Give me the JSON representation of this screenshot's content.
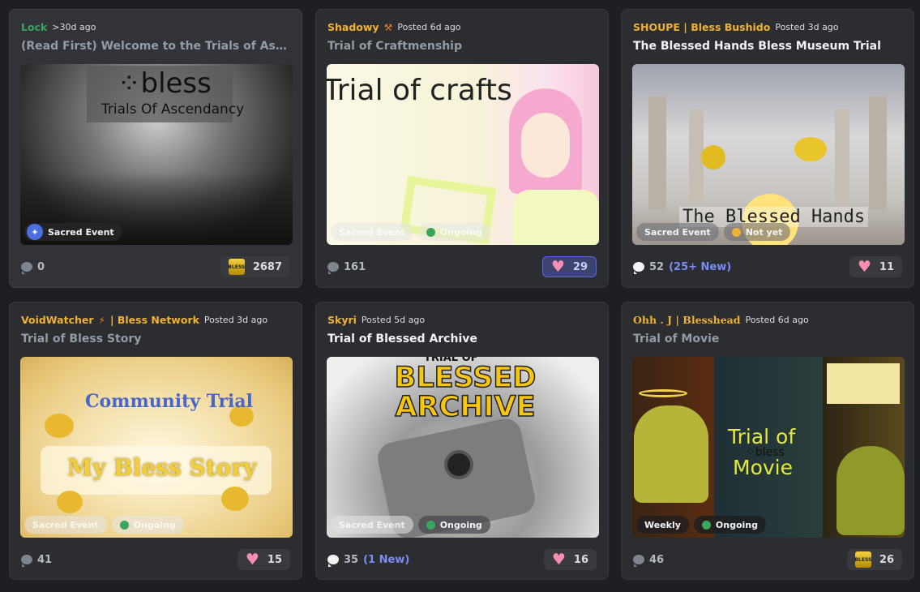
{
  "cards": [
    {
      "author": "Lock",
      "author_color": "#3ba55d",
      "posted": ">30d ago",
      "title": "(Read First) Welcome to the Trials of Ascend…",
      "image_text": {
        "logo": "⁘bless",
        "sub": "Trials Of Ascendancy"
      },
      "tags": [
        "Sacred Event"
      ],
      "comments": "0",
      "new": "",
      "reaction_icon": "bless-emoji",
      "reactions": "2687"
    },
    {
      "author": "Shadowy",
      "author_color": "#f0b232",
      "posted": "Posted 6d ago",
      "title": "Trial of Craftmenship",
      "image_text": {
        "headline": "Trial of crafts"
      },
      "tags": [
        "Sacred Event",
        "Ongoing"
      ],
      "comments": "161",
      "new": "",
      "reaction_icon": "heart-icon",
      "reactions": "29"
    },
    {
      "author": "SHOUPE | Bless Bushido",
      "author_color": "#f0b232",
      "posted": "Posted 3d ago",
      "title": "The Blessed Hands Bless Museum Trial",
      "image_text": {
        "headline": "The Blessed Hands"
      },
      "tags": [
        "Sacred Event",
        "Not yet"
      ],
      "comments": "52",
      "new": "(25+ New)",
      "reaction_icon": "heart-icon",
      "reactions": "11"
    },
    {
      "author": "VoidWatcher",
      "author_suffix": "| Bless Network",
      "author_color": "#f0b232",
      "posted": "Posted 3d ago",
      "title": "Trial of Bless Story",
      "image_text": {
        "top": "Community Trial",
        "bottom": "My Bless Story"
      },
      "tags": [
        "Sacred Event",
        "Ongoing"
      ],
      "comments": "41",
      "new": "",
      "reaction_icon": "heart-icon",
      "reactions": "15"
    },
    {
      "author": "Skyri",
      "author_color": "#f0b232",
      "posted": "Posted 5d ago",
      "title": "Trial of Blessed Archive",
      "image_text": {
        "top": "TRIAL OF",
        "headline": "BLESSED ARCHIVE"
      },
      "tags": [
        "Sacred Event",
        "Ongoing"
      ],
      "comments": "35",
      "new": "(1 New)",
      "reaction_icon": "heart-icon",
      "reactions": "16"
    },
    {
      "author": "Ohh . J | Blesshead",
      "author_color": "#f0b232",
      "posted": "Posted 6d ago",
      "title": "Trial of Movie",
      "image_text": {
        "headline": "Trial of",
        "logo": "⁘bless",
        "sub": "Movie"
      },
      "tags": [
        "Weekly",
        "Ongoing"
      ],
      "comments": "46",
      "new": "",
      "reaction_icon": "bless-emoji",
      "reactions": "26"
    }
  ],
  "colors": {
    "background": "#1e1f22",
    "card": "#2b2d31",
    "active_reaction": "#5865f2",
    "new_text": "#7b8cf5",
    "ongoing": "#3ba55d",
    "not_yet": "#f0b232"
  }
}
